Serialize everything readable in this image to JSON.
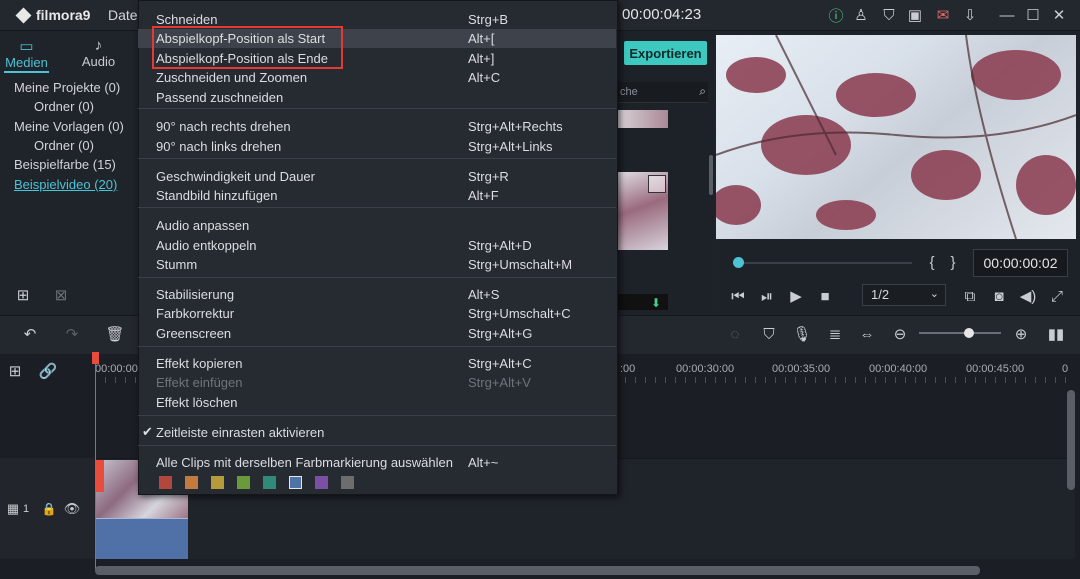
{
  "app": {
    "name": "filmora9",
    "menu_datei": "Datei"
  },
  "top_timecode": "00:00:04:23",
  "left_tabs": {
    "medien": "Medien",
    "audio": "Audio"
  },
  "media_tree": [
    "Meine Projekte (0)",
    "Ordner (0)",
    "Meine Vorlagen (0)",
    "Ordner (0)",
    "Beispielfarbe (15)",
    "Beispielvideo (20)"
  ],
  "export_label": "Exportieren",
  "search_placeholder": "che",
  "preview": {
    "time": "00:00:00:02",
    "ratio": "1/2",
    "progress": 0.02
  },
  "ruler_labels": [
    "00:00:00",
    ":00",
    "00:00:30:00",
    "00:00:35:00",
    "00:00:40:00",
    "00:00:45:00",
    "0"
  ],
  "track_label": "1",
  "context_menu": {
    "groups": [
      [
        {
          "label": "Schneiden",
          "shortcut": "Strg+B"
        },
        {
          "label": "Abspielkopf-Position als Start",
          "shortcut": "Alt+["
        },
        {
          "label": "Abspielkopf-Position als Ende",
          "shortcut": "Alt+]"
        },
        {
          "label": "Zuschneiden und Zoomen",
          "shortcut": "Alt+C"
        },
        {
          "label": "Passend zuschneiden",
          "shortcut": ""
        }
      ],
      [
        {
          "label": "90° nach rechts drehen",
          "shortcut": "Strg+Alt+Rechts"
        },
        {
          "label": "90° nach links drehen",
          "shortcut": "Strg+Alt+Links"
        }
      ],
      [
        {
          "label": "Geschwindigkeit und Dauer",
          "shortcut": "Strg+R"
        },
        {
          "label": "Standbild hinzufügen",
          "shortcut": "Alt+F"
        }
      ],
      [
        {
          "label": "Audio anpassen",
          "shortcut": ""
        },
        {
          "label": "Audio entkoppeln",
          "shortcut": "Strg+Alt+D"
        },
        {
          "label": "Stumm",
          "shortcut": "Strg+Umschalt+M"
        }
      ],
      [
        {
          "label": "Stabilisierung",
          "shortcut": "Alt+S"
        },
        {
          "label": "Farbkorrektur",
          "shortcut": "Strg+Umschalt+C"
        },
        {
          "label": "Greenscreen",
          "shortcut": "Strg+Alt+G"
        }
      ],
      [
        {
          "label": "Effekt kopieren",
          "shortcut": "Strg+Alt+C"
        },
        {
          "label": "Effekt einfügen",
          "shortcut": "Strg+Alt+V"
        },
        {
          "label": "Effekt löschen",
          "shortcut": ""
        }
      ],
      [
        {
          "label": "Zeitleiste einrasten aktivieren",
          "shortcut": ""
        }
      ],
      [
        {
          "label": "Alle Clips mit derselben Farbmarkierung auswählen",
          "shortcut": "Alt+~"
        }
      ]
    ],
    "swatch_colors": [
      "#b2473e",
      "#c27a3f",
      "#b69b3b",
      "#6b9a3c",
      "#2f8a7a",
      "#4f73a7",
      "#7b4fa3",
      "#6d6d6d"
    ]
  },
  "colors": {
    "accent": "#4cc3d6",
    "export_bg": "#3dc9c0",
    "highlight_box": "#e53935",
    "playhead": "#e74c3c"
  }
}
